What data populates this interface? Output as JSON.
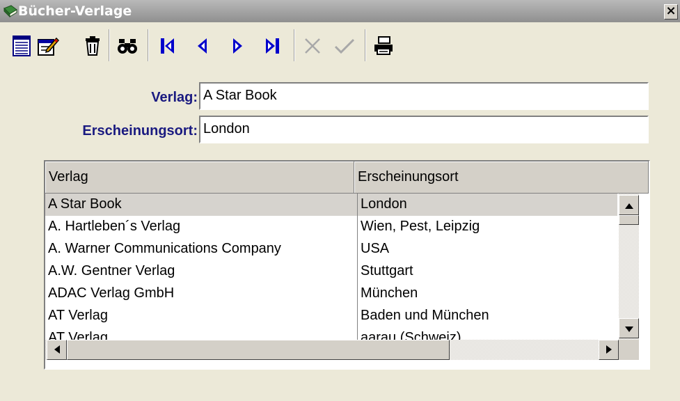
{
  "window": {
    "title": "Bücher-Verlage",
    "close_label": "×"
  },
  "toolbar": {
    "icons": [
      "list-view-icon",
      "edit-record-icon",
      "trash-icon",
      "binoculars-icon",
      "first-record-icon",
      "previous-record-icon",
      "next-record-icon",
      "last-record-icon",
      "cancel-icon",
      "confirm-icon",
      "print-icon"
    ]
  },
  "form": {
    "verlag_label": "Verlag:",
    "verlag_value": "A Star Book",
    "ort_label": "Erscheinungsort:",
    "ort_value": "London"
  },
  "table": {
    "columns": [
      "Verlag",
      "Erscheinungsort"
    ],
    "rows": [
      [
        "A Star Book",
        "London"
      ],
      [
        "A. Hartleben´s Verlag",
        "Wien, Pest, Leipzig"
      ],
      [
        "A. Warner Communications Company",
        "USA"
      ],
      [
        "A.W. Gentner Verlag",
        "Stuttgart"
      ],
      [
        "ADAC Verlag GmbH",
        "München"
      ],
      [
        "AT Verlag",
        "Baden und München"
      ],
      [
        "AT Verlag",
        "aarau (Schweiz)"
      ]
    ],
    "selected_row": 0
  },
  "colors": {
    "label": "#1a1a80",
    "window_bg": "#ece9d8",
    "selected_row": "#d6d3ce"
  }
}
